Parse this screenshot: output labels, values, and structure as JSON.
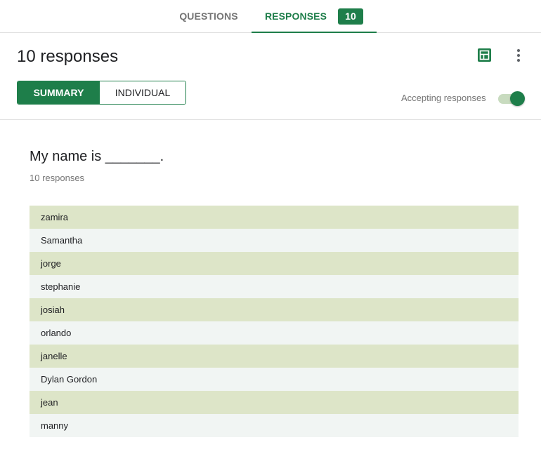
{
  "tabs": {
    "questions_label": "QUESTIONS",
    "responses_label": "RESPONSES",
    "responses_count": "10"
  },
  "header": {
    "title": "10 responses",
    "summary_label": "SUMMARY",
    "individual_label": "INDIVIDUAL",
    "accepting_label": "Accepting responses",
    "accepting_on": true
  },
  "icons": {
    "sheets": "sheets-icon",
    "more": "more-vert-icon"
  },
  "question": {
    "title": "My name is _______.",
    "subtitle": "10 responses",
    "answers": [
      "zamira",
      "Samantha",
      "jorge",
      "stephanie",
      "josiah",
      "orlando",
      "janelle",
      "Dylan Gordon",
      "jean",
      "manny"
    ]
  },
  "colors": {
    "accent": "#1e7e4a",
    "row_odd": "#dde5c8",
    "row_even": "#f1f5f3"
  }
}
